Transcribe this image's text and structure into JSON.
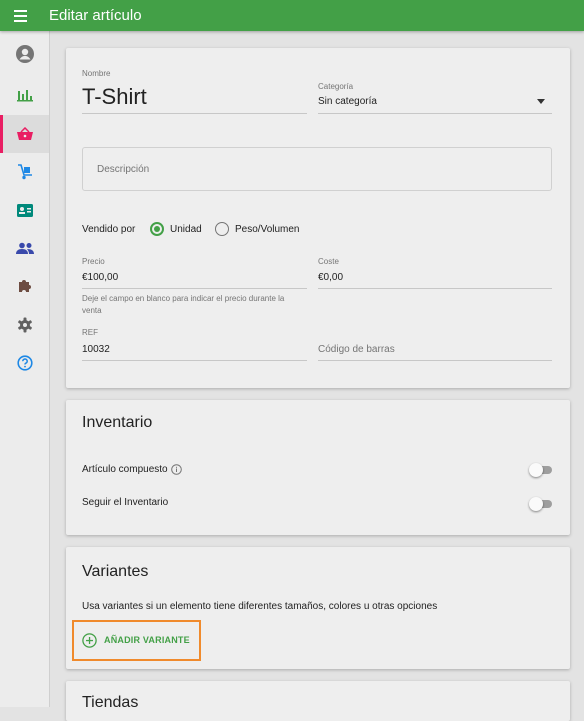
{
  "topbar": {
    "title": "Editar artículo"
  },
  "sidebar": {
    "items": [
      {
        "icon": "account-icon",
        "active": false
      },
      {
        "icon": "reports-icon",
        "active": false
      },
      {
        "icon": "items-basket-icon",
        "active": true
      },
      {
        "icon": "inventory-dolly-icon",
        "active": false
      },
      {
        "icon": "employees-card-icon",
        "active": false
      },
      {
        "icon": "customers-icon",
        "active": false
      },
      {
        "icon": "integrations-puzzle-icon",
        "active": false
      },
      {
        "icon": "settings-icon",
        "active": false
      },
      {
        "icon": "help-icon",
        "active": false
      }
    ]
  },
  "item": {
    "name_label": "Nombre",
    "name_value": "T-Shirt",
    "category_label": "Categoría",
    "category_value": "Sin categoría",
    "description_placeholder": "Descripción",
    "sold_by_label": "Vendido por",
    "sold_by_options": [
      "Unidad",
      "Peso/Volumen"
    ],
    "sold_by_selected": "Unidad",
    "price_label": "Precio",
    "price_value": "€100,00",
    "price_hint_line1": "Deje el campo en blanco para indicar el precio durante la",
    "price_hint_line2": "venta",
    "cost_label": "Coste",
    "cost_value": "€0,00",
    "ref_label": "REF",
    "ref_value": "10032",
    "barcode_placeholder": "Código de barras"
  },
  "inventory": {
    "title": "Inventario",
    "composite_label": "Artículo compuesto",
    "composite_on": false,
    "track_label": "Seguir el Inventario",
    "track_on": false
  },
  "variants": {
    "title": "Variantes",
    "description": "Usa variantes si un elemento tiene diferentes tamaños, colores u otras opciones",
    "add_button": "AÑADIR VARIANTE"
  },
  "stores": {
    "title": "Tiendas"
  },
  "colors": {
    "primary": "#43a047",
    "active_nav": "#e91e63",
    "highlight": "#f08a2c"
  }
}
